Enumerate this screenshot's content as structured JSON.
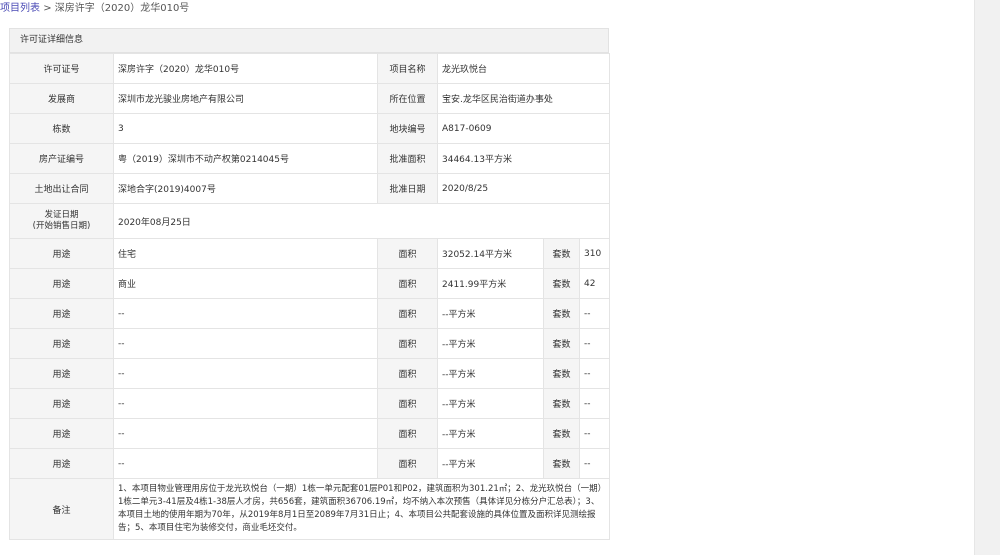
{
  "breadcrumb": {
    "link": "项目列表",
    "separator": ">",
    "current": "深房许字（2020）龙华010号"
  },
  "panel": {
    "title": "许可证详细信息"
  },
  "labels": {
    "license_no": "许可证号",
    "project_name": "项目名称",
    "developer": "发展商",
    "location": "所在位置",
    "buildings": "栋数",
    "plot_no": "地块编号",
    "property_cert": "房产证编号",
    "approved_area": "批准面积",
    "land_contract": "土地出让合同",
    "approved_date": "批准日期",
    "issue_date_1": "发证日期",
    "issue_date_2": "(开始销售日期)",
    "use": "用途",
    "area": "面积",
    "units": "套数",
    "remarks": "备注"
  },
  "details": {
    "license_no": "深房许字（2020）龙华010号",
    "project_name": "龙光玖悦台",
    "developer": "深圳市龙光骏业房地产有限公司",
    "location": "宝安.龙华区民治街道办事处",
    "buildings": "3",
    "plot_no": "A817-0609",
    "property_cert": "粤（2019）深圳市不动产权第0214045号",
    "approved_area": "34464.13平方米",
    "land_contract": "深地合字(2019)4007号",
    "approved_date": "2020/8/25",
    "issue_date": "2020年08月25日"
  },
  "usages": [
    {
      "use": "住宅",
      "area": "32052.14平方米",
      "units": "310"
    },
    {
      "use": "商业",
      "area": "2411.99平方米",
      "units": "42"
    },
    {
      "use": "--",
      "area": "--平方米",
      "units": "--"
    },
    {
      "use": "--",
      "area": "--平方米",
      "units": "--"
    },
    {
      "use": "--",
      "area": "--平方米",
      "units": "--"
    },
    {
      "use": "--",
      "area": "--平方米",
      "units": "--"
    },
    {
      "use": "--",
      "area": "--平方米",
      "units": "--"
    },
    {
      "use": "--",
      "area": "--平方米",
      "units": "--"
    }
  ],
  "remarks": "1、本项目物业管理用房位于龙光玖悦台（一期）1栋一单元配套01层P01和P02，建筑面积为301.21㎡；2、龙光玖悦台（一期）1栋二单元3-41层及4栋1-38层人才房，共656套，建筑面积36706.19㎡，均不纳入本次预售（具体详见分栋分户汇总表）；3、本项目土地的使用年期为70年，从2019年8月1日至2089年7月31日止；4、本项目公共配套设施的具体位置及面积详见测绘报告；5、本项目住宅为装修交付，商业毛坯交付。"
}
